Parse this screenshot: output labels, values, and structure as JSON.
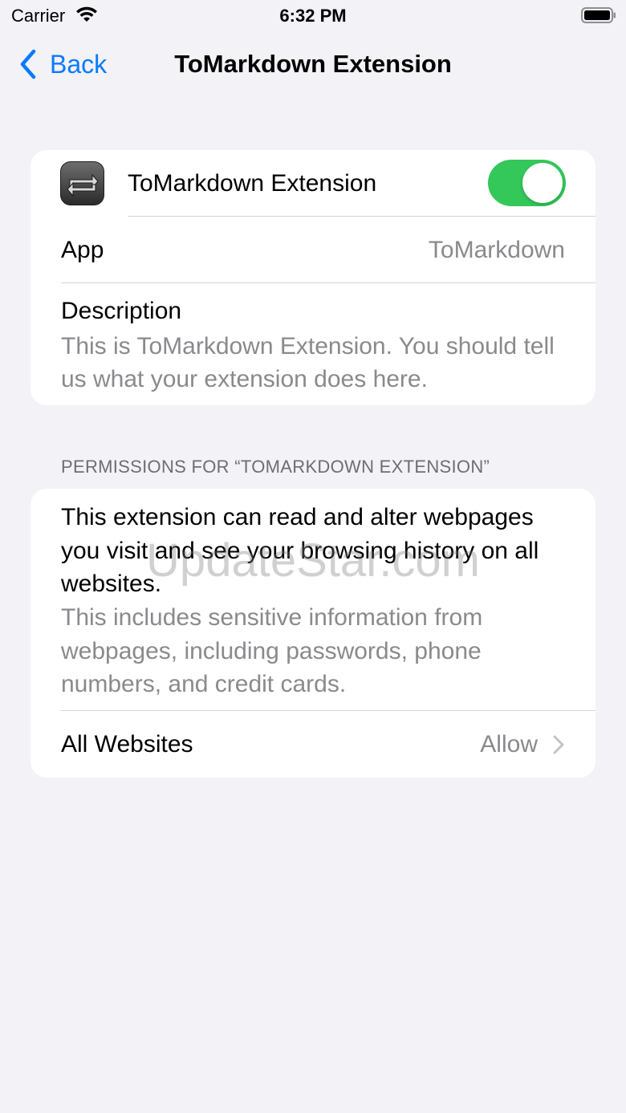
{
  "status_bar": {
    "carrier": "Carrier",
    "time": "6:32 PM",
    "icons": [
      "wifi-icon",
      "battery-icon"
    ]
  },
  "nav": {
    "back_label": "Back",
    "title": "ToMarkdown Extension",
    "accent_color": "#0a7aff"
  },
  "extension": {
    "name": "ToMarkdown Extension",
    "enabled": true,
    "toggle_color": "#34c759",
    "app_label": "App",
    "app_value": "ToMarkdown",
    "description_label": "Description",
    "description_text": "This is ToMarkdown Extension. You should tell us what your extension does here."
  },
  "permissions": {
    "header": "PERMISSIONS FOR “TOMARKDOWN EXTENSION”",
    "main_text": "This extension can read and alter webpages you visit and see your browsing history on all websites.",
    "sub_text": "This includes sensitive information from webpages, including passwords, phone numbers, and credit cards.",
    "all_websites_label": "All Websites",
    "all_websites_value": "Allow"
  },
  "watermark": "UpdateStar.com"
}
